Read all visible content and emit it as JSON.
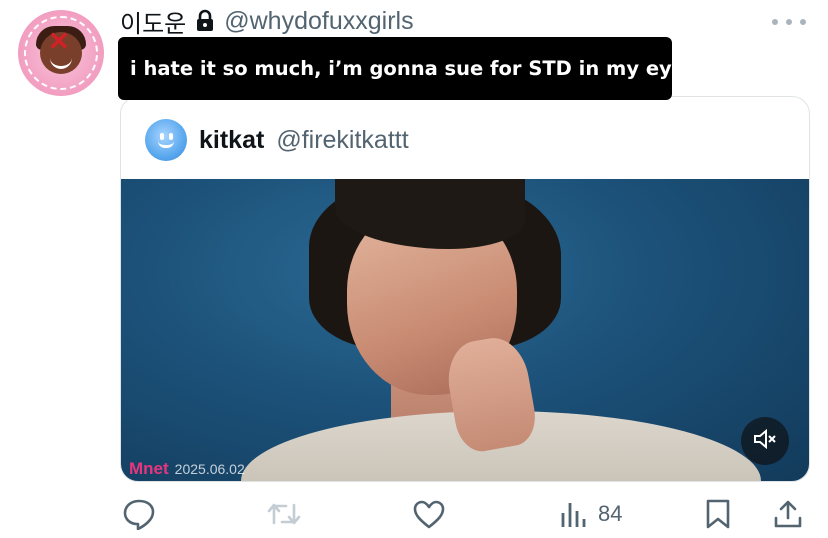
{
  "author": {
    "display_name": "이도운",
    "handle": "@whydofuxxgirls",
    "protected": true
  },
  "caption": "i hate it so much, i’m gonna sue for STD in my eyes",
  "quoted_tweet": {
    "display_name": "kitkat",
    "handle": "@firekitkattt",
    "media": {
      "watermark_logo": "Mnet",
      "watermark_date": "2025.06.02",
      "muted": true
    }
  },
  "actions": {
    "views_count": "84"
  },
  "colors": {
    "text_primary": "#0f1419",
    "text_secondary": "#536471",
    "border": "#dfe3e6",
    "caption_bg": "#000000"
  }
}
